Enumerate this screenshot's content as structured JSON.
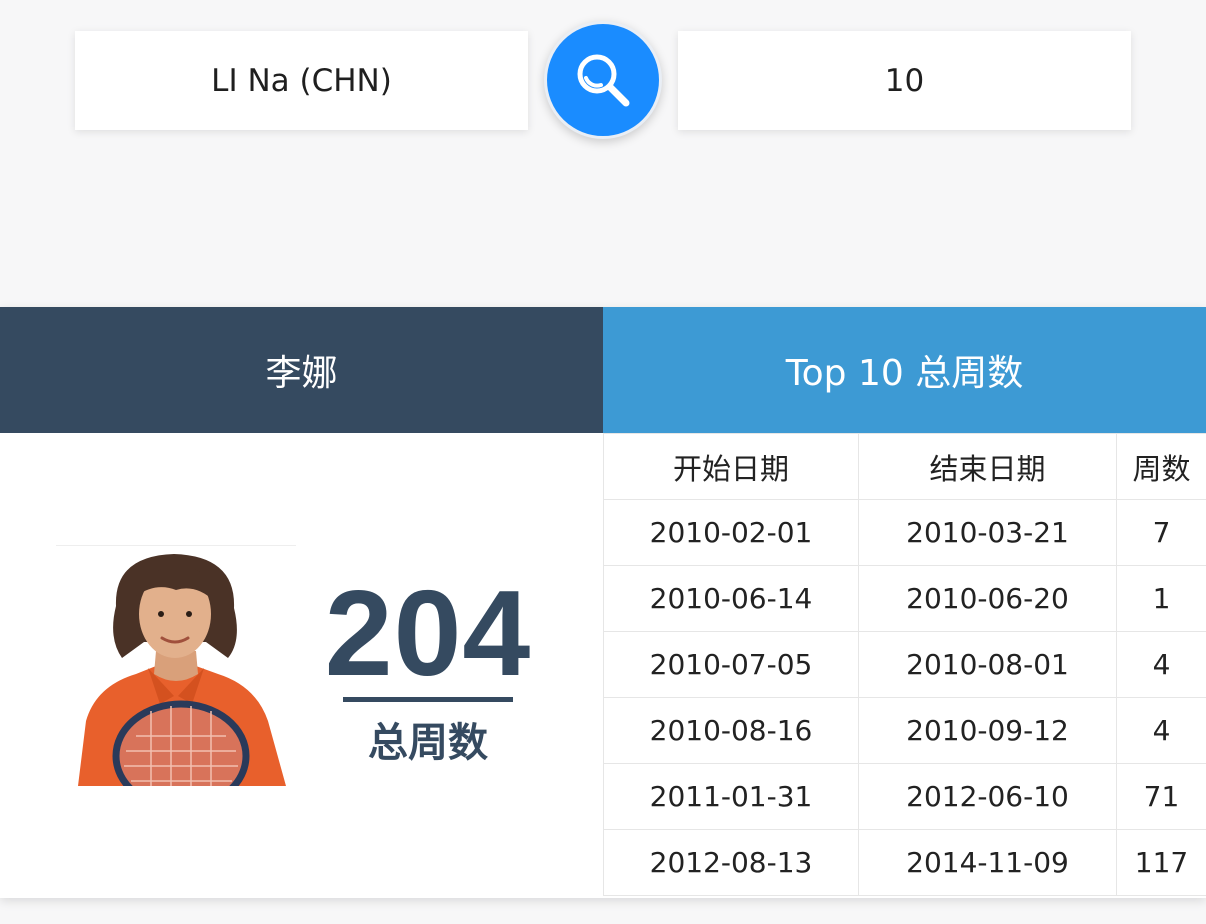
{
  "search": {
    "player_value": "LI Na (CHN)",
    "rank_value": "10"
  },
  "header": {
    "player_name": "李娜",
    "stat_title": "Top 10 总周数"
  },
  "summary": {
    "total_weeks": "204",
    "total_label": "总周数"
  },
  "table": {
    "columns": [
      "开始日期",
      "结束日期",
      "周数"
    ],
    "rows": [
      [
        "2010-02-01",
        "2010-03-21",
        "7"
      ],
      [
        "2010-06-14",
        "2010-06-20",
        "1"
      ],
      [
        "2010-07-05",
        "2010-08-01",
        "4"
      ],
      [
        "2010-08-16",
        "2010-09-12",
        "4"
      ],
      [
        "2011-01-31",
        "2012-06-10",
        "71"
      ],
      [
        "2012-08-13",
        "2014-11-09",
        "117"
      ]
    ]
  },
  "colors": {
    "navy": "#354a60",
    "blue": "#3d9ad4",
    "button": "#1a8cff"
  },
  "icons": {
    "search": "search-icon",
    "player_photo": "player-photo"
  }
}
